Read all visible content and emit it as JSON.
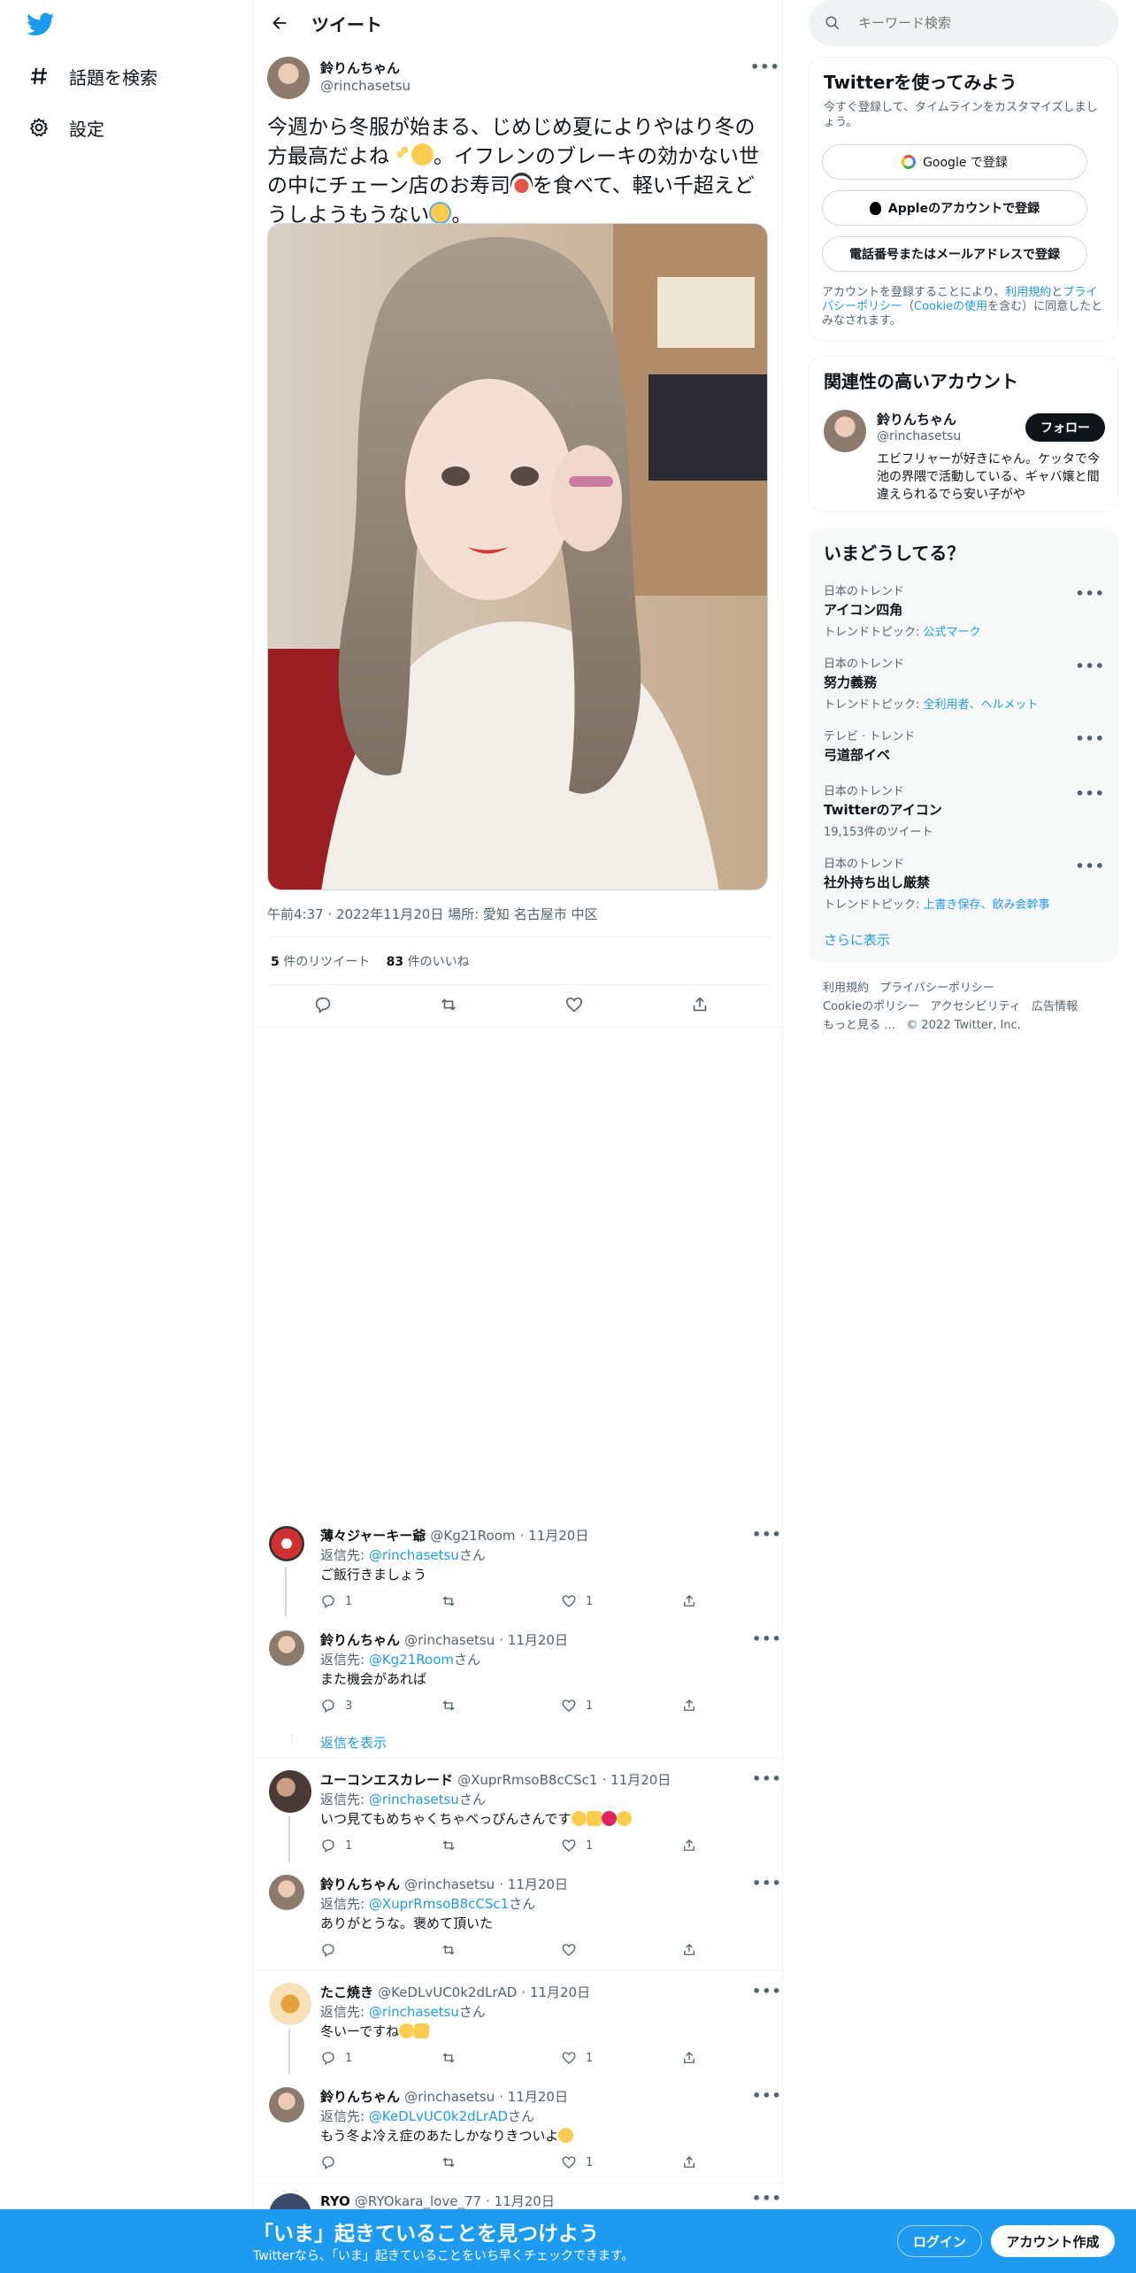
{
  "nav": {
    "items": [
      {
        "label": "話題を検索",
        "icon": "hashtag-icon"
      },
      {
        "label": "設定",
        "icon": "gear-icon"
      }
    ]
  },
  "header": {
    "title": "ツイート"
  },
  "tweet": {
    "author": {
      "name": "鈴りんちゃん",
      "handle": "@rinchasetsu"
    },
    "text_parts": [
      "今週から冬服が始まる、じめじめ夏によりやはり冬の方最高だよね",
      "。イフレンのブレーキの効かない世の中にチェーン店のお寿司",
      "を食べて、軽い千超えどうしようもうない",
      "。"
    ],
    "meta": "午前4:37 · 2022年11月20日 場所: 愛知 名古屋市 中区",
    "retweets_count": "5",
    "retweets_label": " 件のリツイート",
    "likes_count": "83",
    "likes_label": " 件のいいね"
  },
  "replies": [
    {
      "name": "薄々ジャーキー爺",
      "handle": "@Kg21Room",
      "date": "· 11月20日",
      "reply_prefix": "返信先: ",
      "reply_to": "@rinchasetsu",
      "reply_suffix": "さん",
      "text": "ご飯行きましょう",
      "reply_count": "1",
      "like_count": "1"
    },
    {
      "name": "鈴りんちゃん",
      "handle": "@rinchasetsu",
      "date": "· 11月20日",
      "reply_prefix": "返信先: ",
      "reply_to": "@Kg21Room",
      "reply_suffix": "さん",
      "text": "また機会があれば",
      "reply_count": "3",
      "like_count": "1"
    },
    {
      "name": "ユーコンエスカレード",
      "handle": "@XuprRmsoB8cCSc1",
      "date": "· 11月20日",
      "reply_prefix": "返信先: ",
      "reply_to": "@rinchasetsu",
      "reply_suffix": "さん",
      "text": "いつ見てもめちゃくちゃべっぴんさんです",
      "reply_count": "1",
      "like_count": "1"
    },
    {
      "name": "鈴りんちゃん",
      "handle": "@rinchasetsu",
      "date": "· 11月20日",
      "reply_prefix": "返信先: ",
      "reply_to": "@XuprRmsoB8cCSc1",
      "reply_suffix": "さん",
      "text": "ありがとうな。褒めて頂いた",
      "reply_count": "",
      "like_count": ""
    },
    {
      "name": "たこ焼き",
      "handle": "@KeDLvUC0k2dLrAD",
      "date": "· 11月20日",
      "reply_prefix": "返信先: ",
      "reply_to": "@rinchasetsu",
      "reply_suffix": "さん",
      "text": "冬いーですね",
      "reply_count": "1",
      "like_count": "1"
    },
    {
      "name": "鈴りんちゃん",
      "handle": "@rinchasetsu",
      "date": "· 11月20日",
      "reply_prefix": "返信先: ",
      "reply_to": "@KeDLvUC0k2dLrAD",
      "reply_suffix": "さん",
      "text": "もう冬よ冷え症のあたしかなりきついよ",
      "reply_count": "",
      "like_count": "1"
    },
    {
      "name": "RYO",
      "handle": "@RYOkara_love_77",
      "date": "· 11月20日"
    }
  ],
  "show_replies": "返信を表示",
  "search": {
    "placeholder": "キーワード検索"
  },
  "signup": {
    "title": "Twitterを使ってみよう",
    "desc": "今すぐ登録して、タイムラインをカスタマイズしましょう。",
    "google": "Google で登録",
    "apple": "Appleのアカウントで登録",
    "phone": "電話番号またはメールアドレスで登録",
    "terms_a": "アカウントを登録することにより、",
    "terms_link1": "利用規約",
    "terms_b": "と",
    "terms_link2": "プライバシーポリシー",
    "terms_c": "（",
    "terms_link3": "Cookieの使用",
    "terms_d": "を含む）に同意したとみなされます。"
  },
  "related": {
    "title": "関連性の高いアカウント",
    "name": "鈴りんちゃん",
    "handle": "@rinchasetsu",
    "follow": "フォロー",
    "bio": "エビフリャーが好きにゃん。ケッタで今池の界隈で活動している、ギャバ嬢と間違えられるでら安い子がや"
  },
  "trends": {
    "title": "いまどうしてる？",
    "items": [
      {
        "cat": "日本のトレンド",
        "name": "アイコン四角",
        "sub_prefix": "トレンドトピック: ",
        "sub_link": "公式マーク"
      },
      {
        "cat": "日本のトレンド",
        "name": "努力義務",
        "sub_prefix": "トレンドトピック: ",
        "sub_link": "全利用者、ヘルメット"
      },
      {
        "cat": "テレビ · トレンド",
        "name": "弓道部イベ",
        "sub_prefix": "",
        "sub_link": ""
      },
      {
        "cat": "日本のトレンド",
        "name": "Twitterのアイコン",
        "sub_prefix": "19,153件のツイート",
        "sub_link": ""
      },
      {
        "cat": "日本のトレンド",
        "name": "社外持ち出し厳禁",
        "sub_prefix": "トレンドトピック: ",
        "sub_link": "上書き保存、飲み会幹事"
      }
    ],
    "more": "さらに表示"
  },
  "footer": {
    "links": [
      "利用規約",
      "プライバシーポリシー",
      "Cookieのポリシー",
      "アクセシビリティ",
      "広告情報",
      "もっと見る …"
    ],
    "copyright": "© 2022 Twitter, Inc."
  },
  "banner": {
    "title": "「いま」起きていることを見つけよう",
    "subtitle": "Twitterなら、「いま」起きていることをいち早くチェックできます。",
    "login": "ログイン",
    "signup": "アカウント作成"
  },
  "colors": {
    "accent": "#1d9bf0",
    "text": "#0f1419",
    "muted": "#536471"
  }
}
